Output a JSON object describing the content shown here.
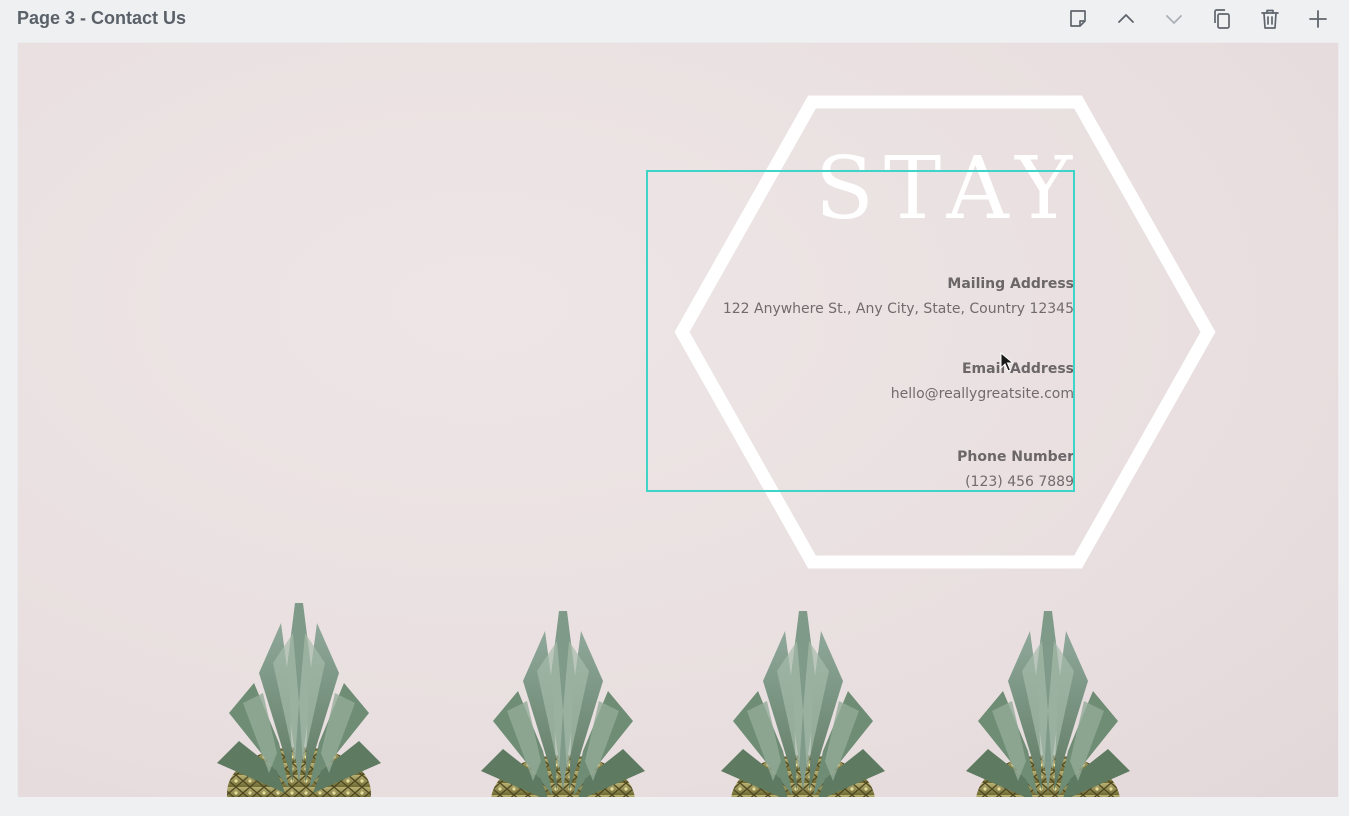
{
  "header": {
    "page_title": "Page 3 - Contact Us",
    "tools": [
      {
        "icon": "notes-icon"
      },
      {
        "icon": "chevron-up-icon"
      },
      {
        "icon": "chevron-down-icon"
      },
      {
        "icon": "duplicate-icon"
      },
      {
        "icon": "trash-icon"
      },
      {
        "icon": "add-icon"
      }
    ]
  },
  "design": {
    "headline": "STAY",
    "mailing_label": "Mailing Address",
    "mailing_value": "122 Anywhere St., Any City, State, Country 12345",
    "email_label": "Email Address",
    "email_value": "hello@reallygreatsite.com",
    "phone_label": "Phone Number",
    "phone_value": "(123) 456 7889"
  },
  "colors": {
    "selection": "#3fd4c8",
    "background": "#e8dfe0",
    "hexagon": "#ffffff"
  }
}
